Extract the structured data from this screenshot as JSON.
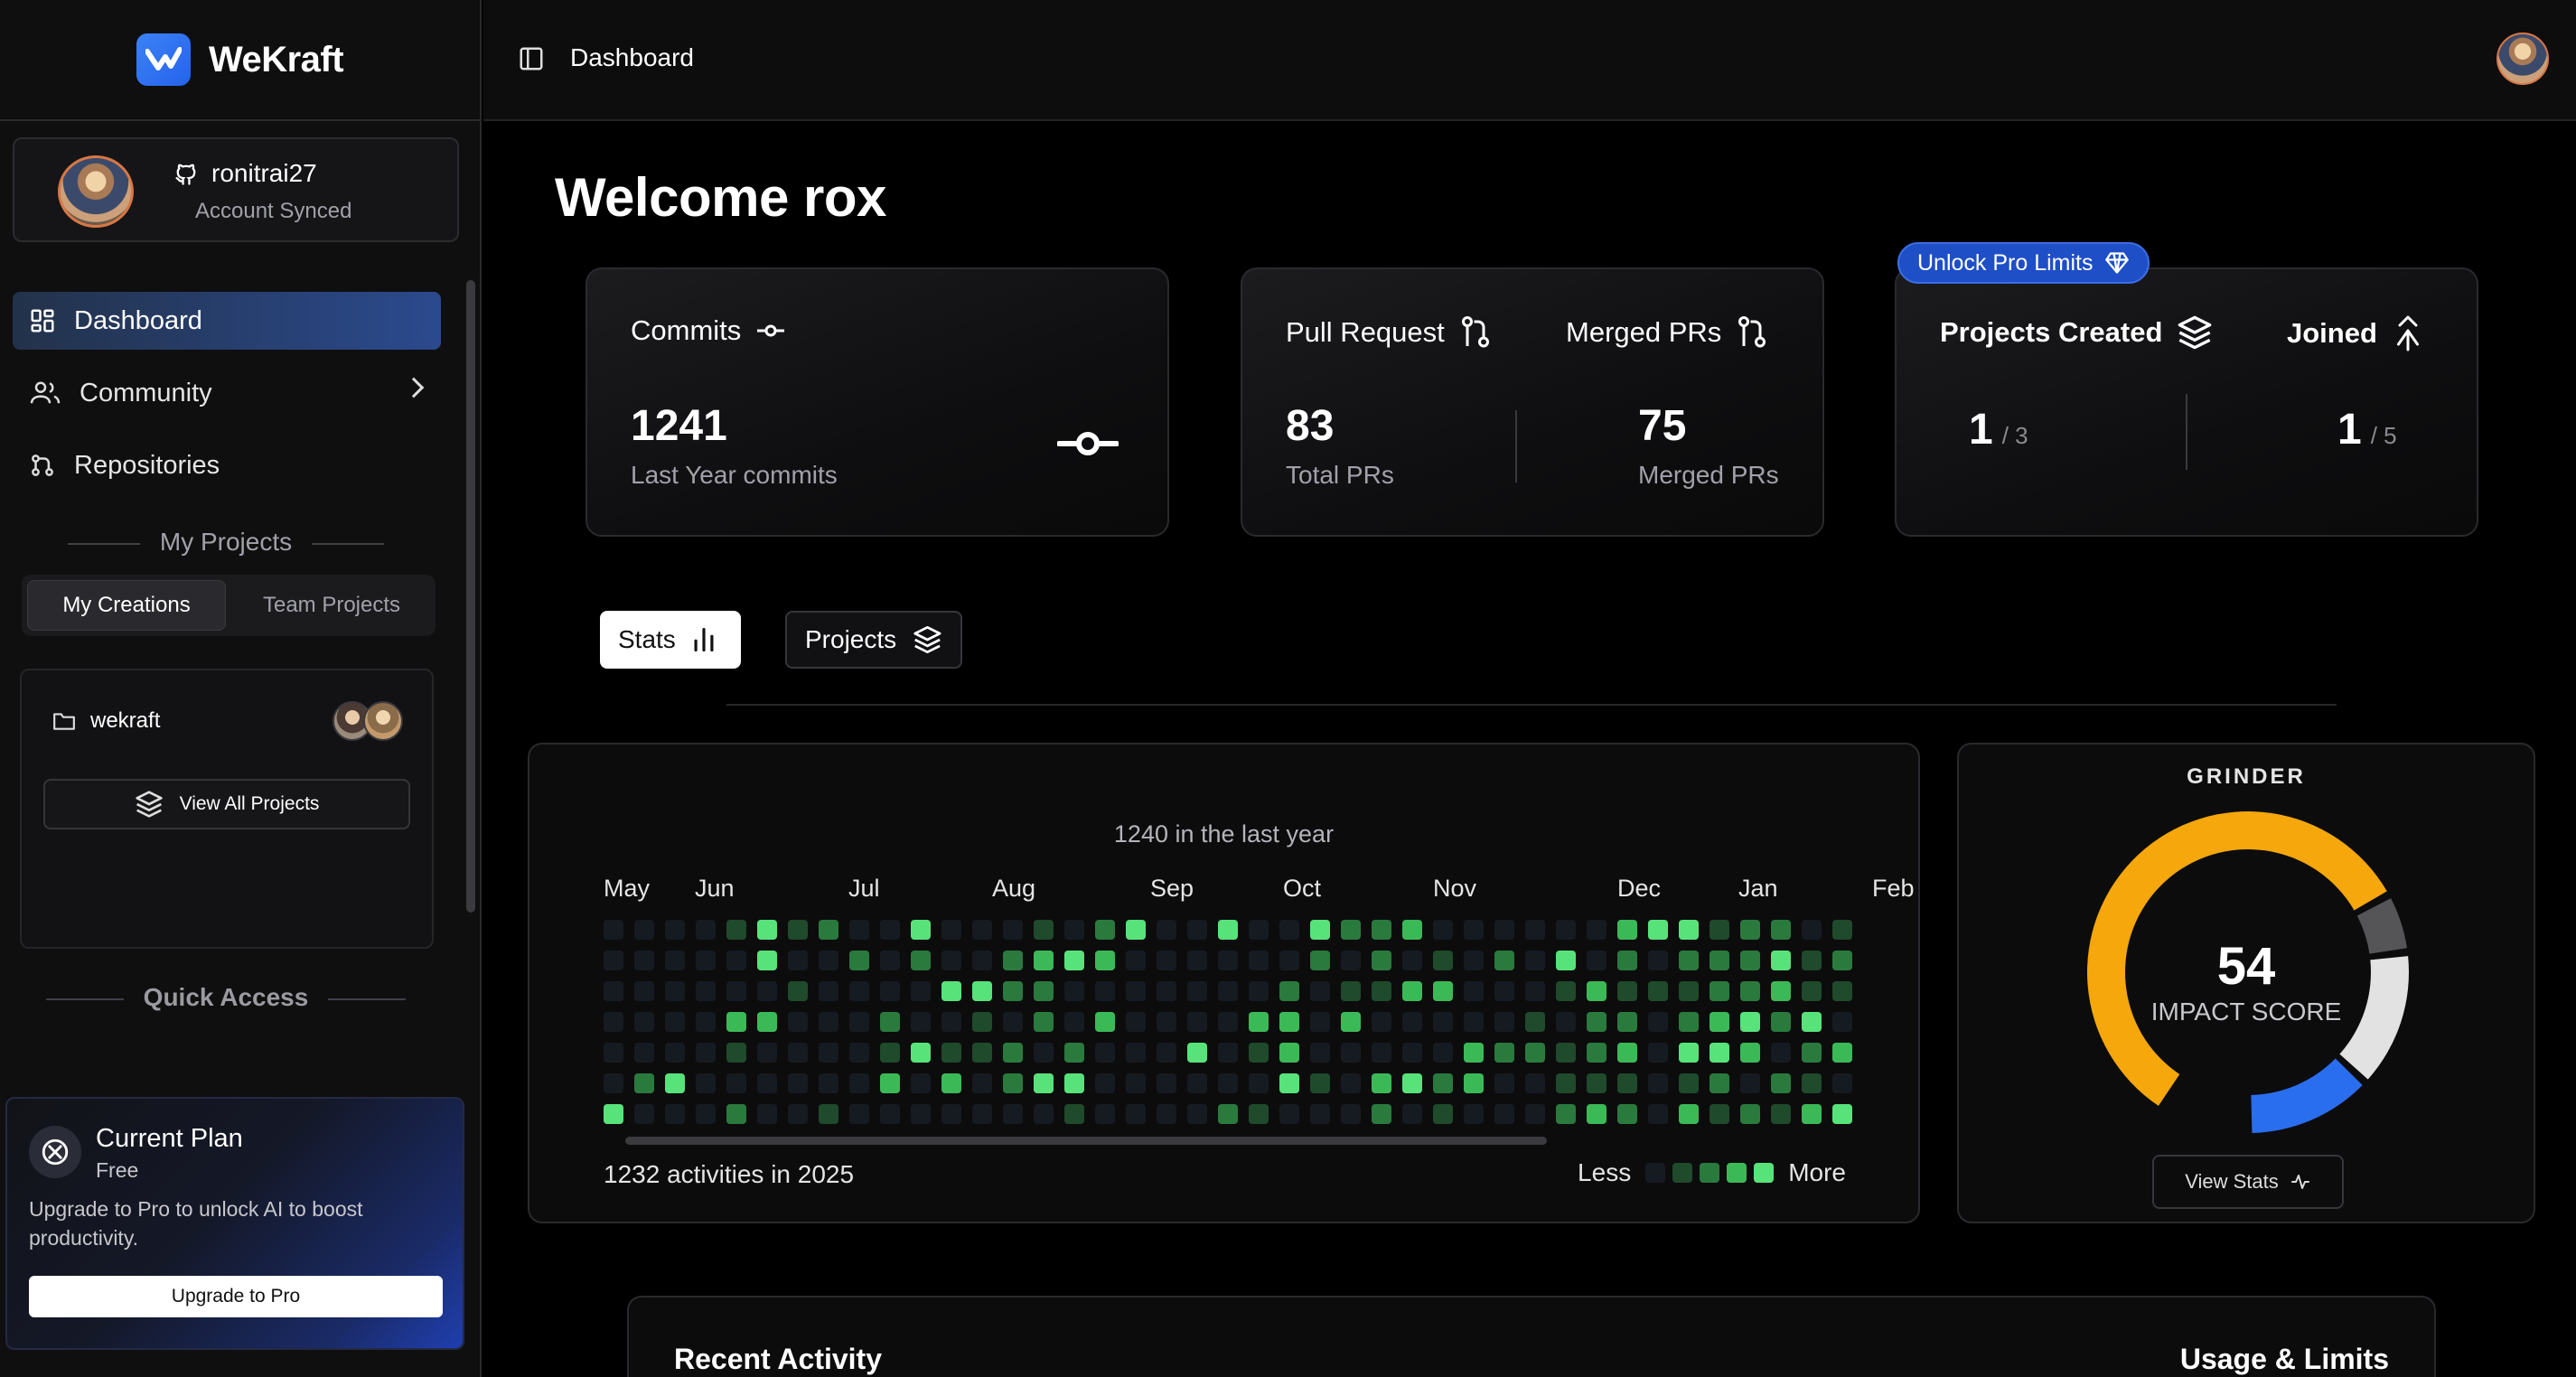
{
  "brand": {
    "name": "WeKraft"
  },
  "account": {
    "username": "ronitrai27",
    "status": "Account Synced"
  },
  "nav": {
    "dashboard": "Dashboard",
    "community": "Community",
    "repositories": "Repositories"
  },
  "my_projects": {
    "title": "My Projects",
    "tabs": [
      "My Creations",
      "Team Projects"
    ],
    "active_tab": "My Creations",
    "items": [
      {
        "name": "wekraft"
      }
    ],
    "view_all": "View All Projects"
  },
  "quick_access": {
    "title": "Quick Access"
  },
  "plan": {
    "title": "Current Plan",
    "tier": "Free",
    "description": "Upgrade to Pro to unlock AI to boost productivity.",
    "button": "Upgrade to Pro"
  },
  "header": {
    "breadcrumb": "Dashboard"
  },
  "welcome": "Welcome rox",
  "cards": {
    "commits": {
      "label": "Commits",
      "value": "1241",
      "sub": "Last Year commits"
    },
    "prs": {
      "label": "Pull Request",
      "value": "83",
      "sub": "Total PRs",
      "merged_label": "Merged PRs",
      "merged_value": "75",
      "merged_sub": "Merged PRs"
    },
    "projects": {
      "badge": "Unlock Pro Limits",
      "created_label": "Projects Created",
      "created_value": "1",
      "created_limit": "/ 3",
      "joined_label": "Joined",
      "joined_value": "1",
      "joined_limit": "/ 5"
    }
  },
  "view_tabs": {
    "stats": "Stats",
    "projects": "Projects",
    "active": "Stats"
  },
  "activity": {
    "headline": "1240 in the last year",
    "months": [
      "May",
      "Jun",
      "Jul",
      "Aug",
      "Sep",
      "Oct",
      "Nov",
      "Dec",
      "Jan",
      "Feb"
    ],
    "total": "1232 activities in 2025",
    "legend_less": "Less",
    "legend_more": "More",
    "levels_colors": [
      "#161b22",
      "#1f4a2b",
      "#2a7a3d",
      "#3cb957",
      "#57e37a"
    ]
  },
  "grinder": {
    "title": "GRINDER",
    "score": "54",
    "score_label": "IMPACT SCORE",
    "button": "View Stats",
    "segments": [
      {
        "color": "#f5a70b",
        "fraction": 0.58
      },
      {
        "color": "#555558",
        "fraction": 0.06
      },
      {
        "color": "#e2e2e2",
        "fraction": 0.14
      },
      {
        "color": "#2a6ef0",
        "fraction": 0.13
      }
    ]
  },
  "bottom": {
    "recent": "Recent Activity",
    "usage": "Usage & Limits"
  },
  "colors": {
    "accent": "#2b4a8e",
    "brand": "#3b82f6",
    "badge": "#1e4fc7"
  }
}
